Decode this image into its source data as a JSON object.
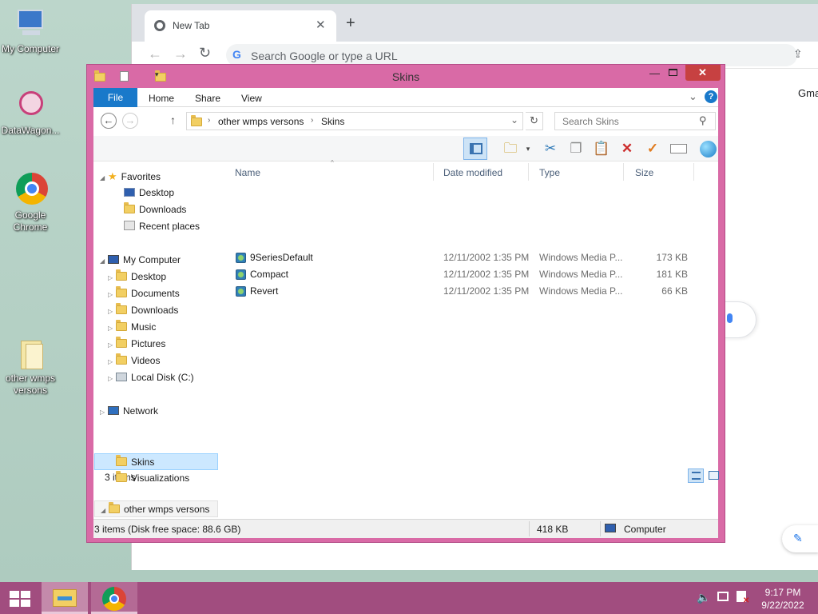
{
  "desktop": {
    "icons": [
      {
        "label": "My Computer"
      },
      {
        "label": "DataWagon..."
      },
      {
        "label": "Google Chrome"
      },
      {
        "label": "other wmps versons"
      }
    ]
  },
  "chrome": {
    "tab_title": "New Tab",
    "omnibox_placeholder": "Search Google or type a URL",
    "page_link": "Gma"
  },
  "explorer": {
    "title": "Skins",
    "ribbon_tabs": [
      "File",
      "Home",
      "Share",
      "View"
    ],
    "breadcrumb": [
      "other wmps versons",
      "Skins"
    ],
    "search_placeholder": "Search Skins",
    "columns": {
      "name": "Name",
      "date": "Date modified",
      "type": "Type",
      "size": "Size"
    },
    "files": [
      {
        "name": "9SeriesDefault",
        "date": "12/11/2002 1:35 PM",
        "type": "Windows Media P...",
        "size": "173 KB"
      },
      {
        "name": "Compact",
        "date": "12/11/2002 1:35 PM",
        "type": "Windows Media P...",
        "size": "181 KB"
      },
      {
        "name": "Revert",
        "date": "12/11/2002 1:35 PM",
        "type": "Windows Media P...",
        "size": "66 KB"
      }
    ],
    "nav": {
      "favorites": {
        "label": "Favorites",
        "items": [
          "Desktop",
          "Downloads",
          "Recent places"
        ]
      },
      "computer": {
        "label": "My Computer",
        "items": [
          "Desktop",
          "Documents",
          "Downloads",
          "Music",
          "Pictures",
          "Videos",
          "Local Disk (C:)"
        ]
      },
      "network": {
        "label": "Network"
      },
      "folder": {
        "label": "other wmps versons",
        "items": [
          "Skins",
          "Visualizations"
        ]
      }
    },
    "item_count": "3 items",
    "status": {
      "left": "3 items (Disk free space: 88.6 GB)",
      "size": "418 KB",
      "location": "Computer"
    }
  },
  "taskbar": {
    "time": "9:17 PM",
    "date": "9/22/2022"
  },
  "colors": {
    "accent": "#d96aa6",
    "file_tab": "#1979ca",
    "taskbar": "#a14d7f"
  }
}
